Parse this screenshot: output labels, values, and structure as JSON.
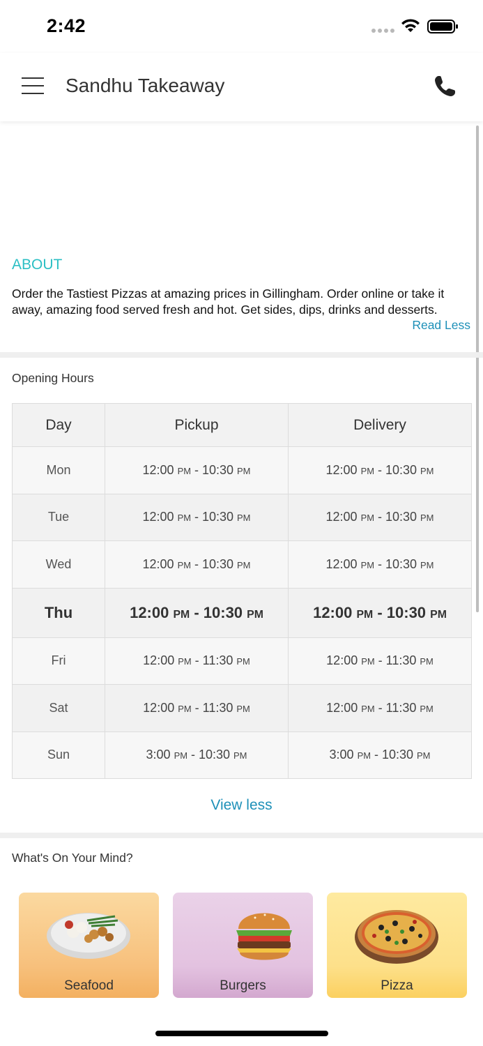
{
  "status_bar": {
    "time": "2:42"
  },
  "header": {
    "title": "Sandhu Takeaway"
  },
  "about": {
    "heading": "ABOUT",
    "text": "Order the Tastiest Pizzas at amazing prices in Gillingham. Order online or take it away, amazing food served fresh and hot. Get sides, dips, drinks and desserts.",
    "toggle_label": "Read Less"
  },
  "opening_hours": {
    "heading": "Opening Hours",
    "columns": [
      "Day",
      "Pickup",
      "Delivery"
    ],
    "rows": [
      {
        "day": "Mon",
        "pickup": "12:00 PM - 10:30 PM",
        "delivery": "12:00 PM - 10:30 PM"
      },
      {
        "day": "Tue",
        "pickup": "12:00 PM - 10:30 PM",
        "delivery": "12:00 PM - 10:30 PM"
      },
      {
        "day": "Wed",
        "pickup": "12:00 PM - 10:30 PM",
        "delivery": "12:00 PM - 10:30 PM"
      },
      {
        "day": "Thu",
        "pickup": "12:00 PM - 10:30 PM",
        "delivery": "12:00 PM - 10:30 PM"
      },
      {
        "day": "Fri",
        "pickup": "12:00 PM - 11:30 PM",
        "delivery": "12:00 PM - 11:30 PM"
      },
      {
        "day": "Sat",
        "pickup": "12:00 PM - 11:30 PM",
        "delivery": "12:00 PM - 11:30 PM"
      },
      {
        "day": "Sun",
        "pickup": "3:00 PM - 10:30 PM",
        "delivery": "3:00 PM - 10:30 PM"
      }
    ],
    "toggle_label": "View less"
  },
  "mind": {
    "heading": "What's On Your Mind?",
    "categories": [
      {
        "label": "Seafood",
        "icon": "seafood-dish-icon"
      },
      {
        "label": "Burgers",
        "icon": "burger-icon"
      },
      {
        "label": "Pizza",
        "icon": "pizza-icon"
      }
    ]
  },
  "colors": {
    "accent_teal": "#2bbfc4",
    "link_blue": "#1e90b8"
  }
}
